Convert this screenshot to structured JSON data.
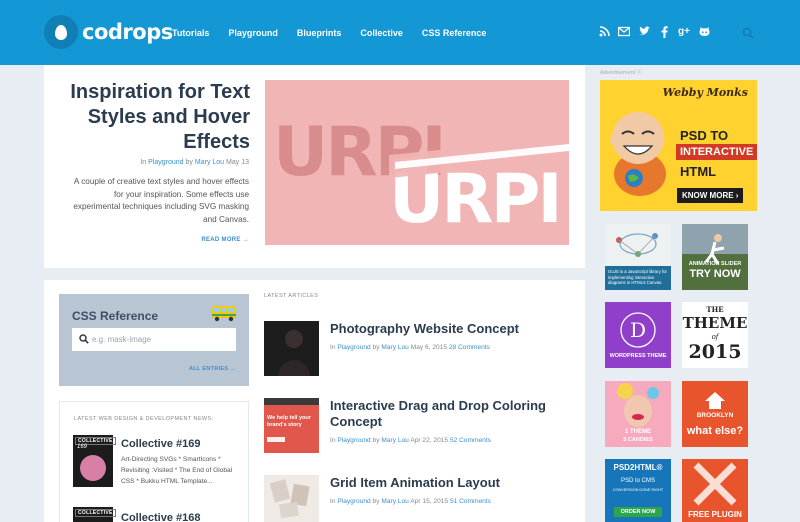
{
  "header": {
    "logo_text": "codrops",
    "nav": [
      "Tutorials",
      "Playground",
      "Blueprints",
      "Collective",
      "CSS Reference"
    ],
    "social_icons": [
      "rss-icon",
      "mail-icon",
      "twitter-icon",
      "facebook-icon",
      "google-plus-icon",
      "github-icon"
    ],
    "search_icon": "search-icon"
  },
  "feature": {
    "title": "Inspiration for Text Styles and Hover Effects",
    "meta_in": "In",
    "meta_category": "Playground",
    "meta_by": "by",
    "meta_author": "Mary Lou",
    "meta_date": "May 13",
    "description": "A couple of creative text styles and hover effects for your inspiration. Some effects use experimental techniques including SVG masking and Canvas.",
    "read_more": "READ MORE →",
    "image_text_back": "URPI",
    "image_text_front": "URPI"
  },
  "css_reference": {
    "title": "CSS Reference",
    "placeholder": "e.g. mask-image",
    "all_entries": "ALL ENTRIES →"
  },
  "news": {
    "heading": "LATEST WEB DESIGN & DEVELOPMENT NEWS:",
    "items": [
      {
        "badge": "COLLECTIVE",
        "number": "169",
        "title": "Collective #169",
        "description": "Art-Directing SVGs * SmartIcons * Revisiting :Visited * The End of Global CSS * Bukku HTML Template..."
      },
      {
        "badge": "COLLECTIVE",
        "title": "Collective #168"
      }
    ]
  },
  "latest": {
    "heading": "LATEST ARTICLES",
    "articles": [
      {
        "title": "Photography Website Concept",
        "category": "Playground",
        "author": "Mary Lou",
        "date": "May 6, 2015",
        "comments": "28 Comments"
      },
      {
        "title": "Interactive Drag and Drop Coloring Concept",
        "category": "Playground",
        "author": "Mary Lou",
        "date": "Apr 22, 2015",
        "comments": "52 Comments",
        "thumb_text": "We help tell your brand's story"
      },
      {
        "title": "Grid Item Animation Layout",
        "category": "Playground",
        "author": "Mary Lou",
        "date": "Apr 15, 2015",
        "comments": "51 Comments"
      }
    ],
    "meta_in": "In",
    "meta_by": "by"
  },
  "sidebar": {
    "ad_label": "Advertisement",
    "big_ad": {
      "brand": "Webby Monks",
      "line1": "PSD TO",
      "line2": "INTERACTIVE",
      "line3": "HTML",
      "button": "KNOW MORE ›"
    },
    "tiles": [
      {
        "text": "GoJS is a JavaScript library for implementing interactive diagrams in HTML5 Canvas."
      },
      {
        "line1": "ANIMATION SLIDER",
        "line2": "TRY NOW"
      },
      {
        "symbol": "D",
        "line1": "WORDPRESS THEME"
      },
      {
        "line1": "THE",
        "line2": "THEME",
        "line3": "of",
        "line4": "2015"
      },
      {
        "line1": "1 THEME",
        "line2": "5 CANDIES"
      },
      {
        "line1": "BROOKLYN",
        "line2": "what else?"
      },
      {
        "line1": "PSD2HTML®",
        "line2": "PSD to CMS",
        "line3": "CONVERSION DONE RIGHT",
        "line4": "ORDER NOW"
      },
      {
        "line1": "FREE PLUGIN"
      }
    ]
  }
}
